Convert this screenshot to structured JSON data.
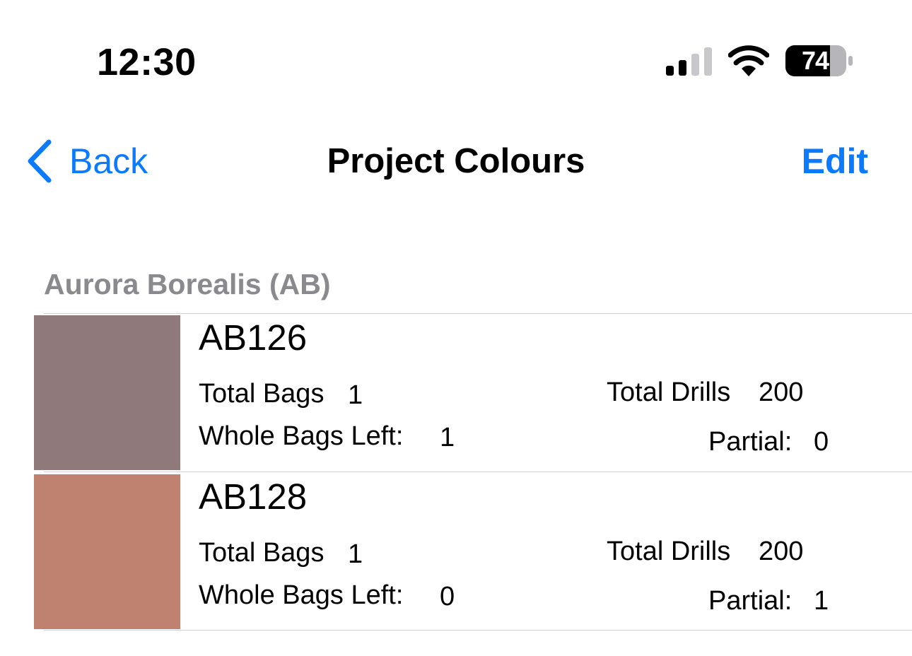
{
  "status_bar": {
    "time": "12:30",
    "battery_level": "74",
    "signal_bars_active": 2,
    "signal_bars_total": 4,
    "icons": [
      "cellular-signal-icon",
      "wifi-icon",
      "battery-icon"
    ]
  },
  "nav": {
    "back_label": "Back",
    "title": "Project Colours",
    "edit_label": "Edit",
    "accent_color": "#0a7aff",
    "back_icon": "chevron-left-icon"
  },
  "section": {
    "header": "Aurora Borealis (AB)"
  },
  "labels": {
    "total_bags": "Total Bags",
    "total_drills": "Total Drills",
    "whole_bags_left": "Whole Bags Left:",
    "partial": "Partial:"
  },
  "items": [
    {
      "code": "AB126",
      "color": "#8f797b",
      "total_bags": "1",
      "total_drills": "200",
      "whole_bags_left": "1",
      "partial": "0"
    },
    {
      "code": "AB128",
      "color": "#bf8170",
      "total_bags": "1",
      "total_drills": "200",
      "whole_bags_left": "0",
      "partial": "1"
    }
  ]
}
